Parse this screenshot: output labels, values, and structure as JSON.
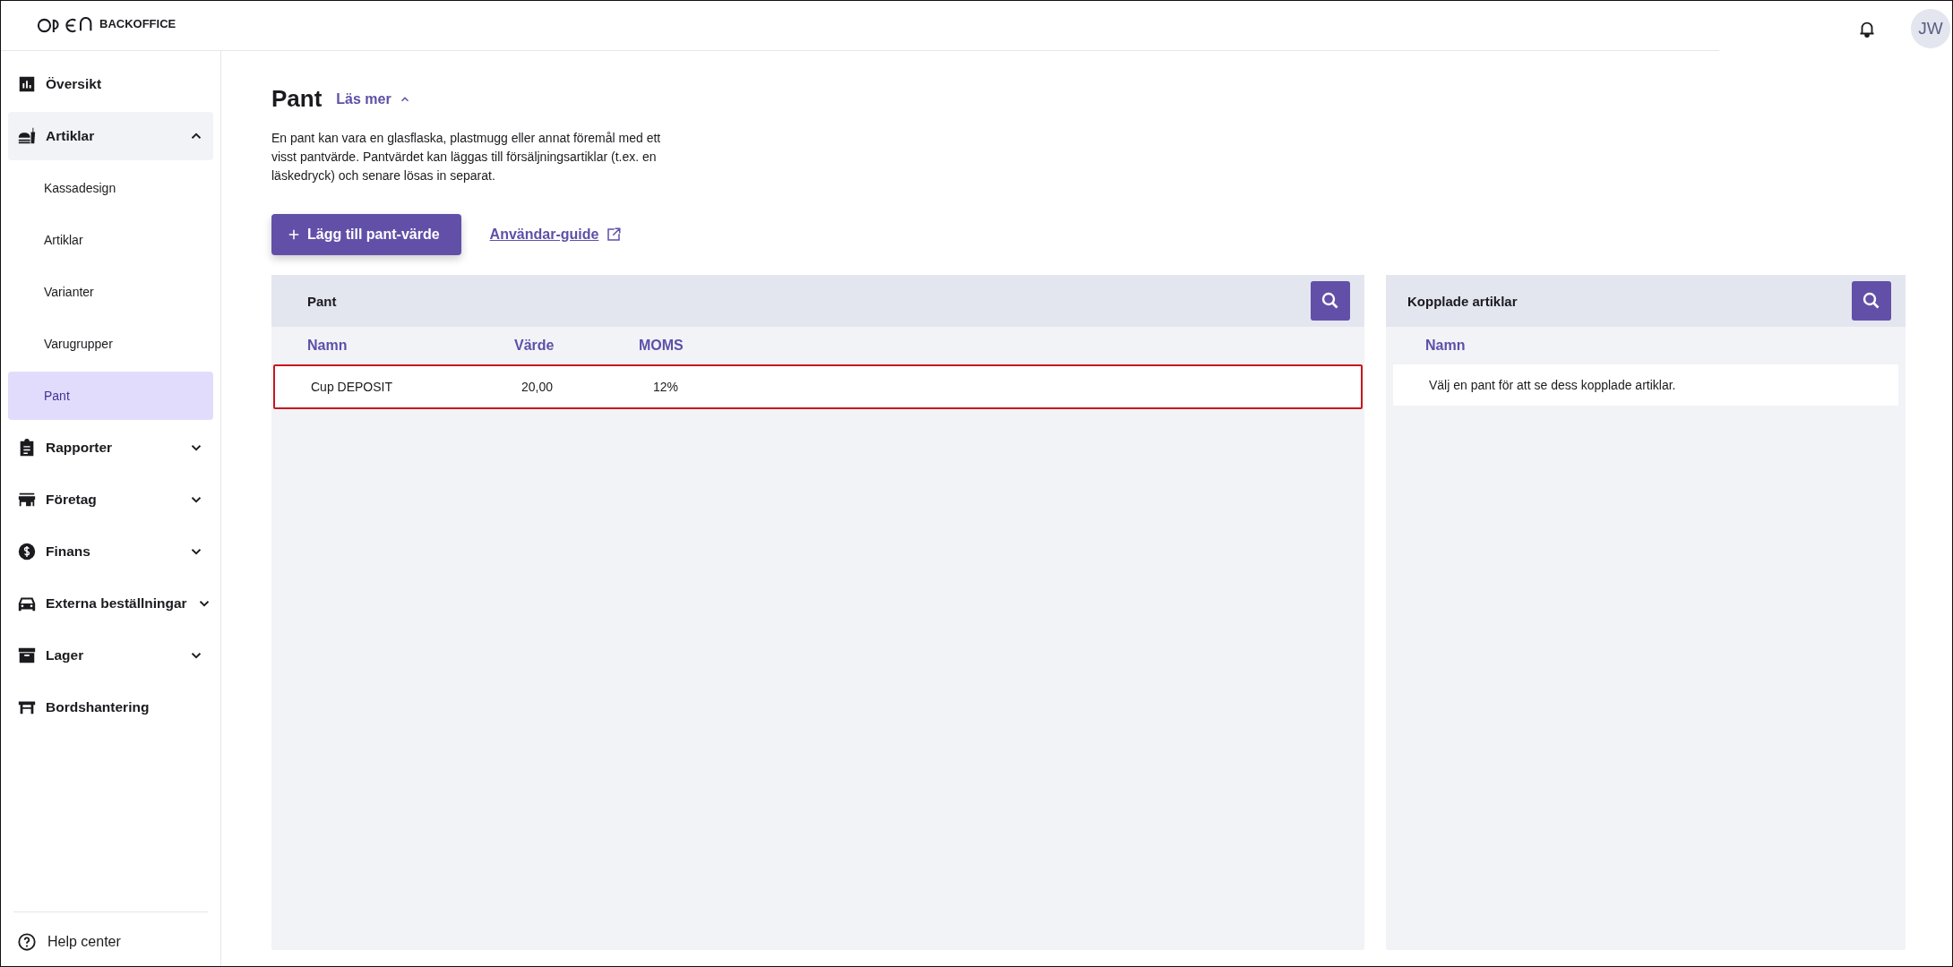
{
  "brand": {
    "name": "BACKOFFICE"
  },
  "user": {
    "initials": "JW"
  },
  "sidebar": {
    "items": [
      {
        "label": "Översikt",
        "kind": "link"
      },
      {
        "label": "Artiklar",
        "kind": "group",
        "expanded": true,
        "children": [
          {
            "label": "Kassadesign",
            "selected": false
          },
          {
            "label": "Artiklar",
            "selected": false
          },
          {
            "label": "Varianter",
            "selected": false
          },
          {
            "label": "Varugrupper",
            "selected": false
          },
          {
            "label": "Pant",
            "selected": true
          }
        ]
      },
      {
        "label": "Rapporter",
        "kind": "group",
        "expanded": false
      },
      {
        "label": "Företag",
        "kind": "group",
        "expanded": false
      },
      {
        "label": "Finans",
        "kind": "group",
        "expanded": false
      },
      {
        "label": "Externa beställningar",
        "kind": "group",
        "expanded": false
      },
      {
        "label": "Lager",
        "kind": "group",
        "expanded": false
      },
      {
        "label": "Bordshantering",
        "kind": "link"
      }
    ],
    "help": "Help center"
  },
  "page": {
    "title": "Pant",
    "read_more": {
      "label": "Läs mer",
      "expanded": true
    },
    "description": "En pant kan vara en glasflaska, plastmugg eller annat föremål med ett visst pantvärde. Pantvärdet kan läggas till försäljningsartiklar (t.ex. en läskedryck) och senare lösas in separat.",
    "add_button": "Lägg till pant-värde",
    "guide_link": "Användar-guide"
  },
  "pant_table": {
    "title": "Pant",
    "columns": [
      "Namn",
      "Värde",
      "MOMS"
    ],
    "rows": [
      {
        "name": "Cup DEPOSIT",
        "value": "20,00",
        "vat": "12%",
        "selected": true
      }
    ]
  },
  "linked_table": {
    "title": "Kopplade artiklar",
    "columns": [
      "Namn"
    ],
    "empty_message": "Välj en pant för att se dess kopplade artiklar."
  }
}
